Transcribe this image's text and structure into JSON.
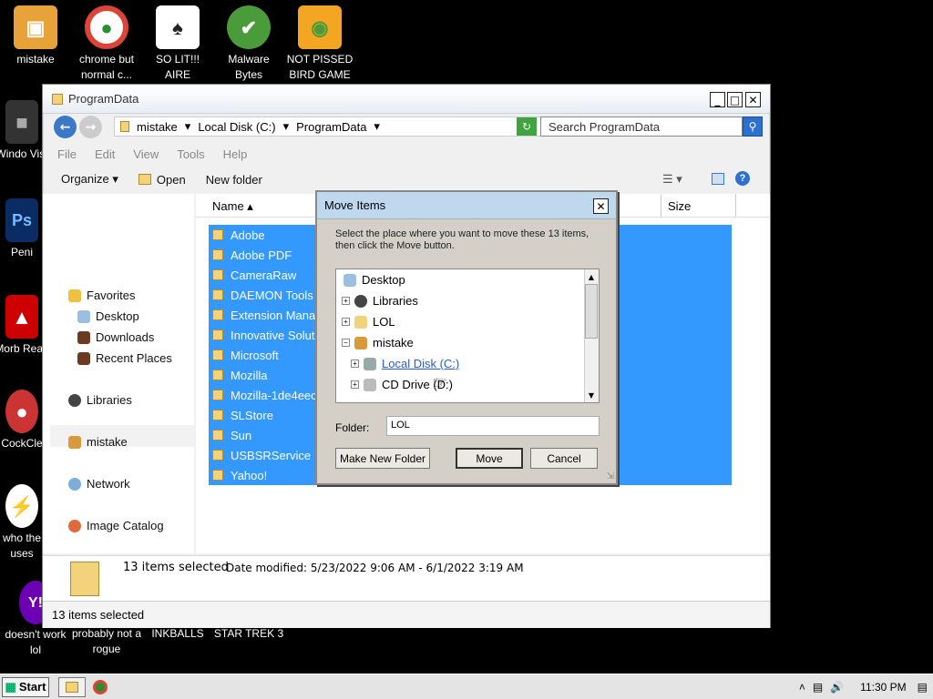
{
  "desktop": {
    "icons": [
      {
        "label": "mistake",
        "glyph": "▣",
        "color": "#e8a23a"
      },
      {
        "label": "chrome but normal c...",
        "glyph": "●",
        "color": "#2a8d2f"
      },
      {
        "label": "SO LIT!!! AIRE",
        "glyph": "♠",
        "color": "#444"
      },
      {
        "label": "Malware Bytes",
        "glyph": "✔",
        "color": "#2b8a2b"
      },
      {
        "label": "NOT PISSED BIRD GAME",
        "glyph": "◉",
        "color": "#f3a622"
      },
      {
        "label": "Windo Vist",
        "glyph": "■",
        "color": "#333"
      },
      {
        "label": "Ps",
        "glyph": "Ps",
        "color": "#0b2b63"
      },
      {
        "label": "Peni",
        "glyph": "",
        "color": "#000"
      },
      {
        "label": "Morb Read",
        "glyph": "▲",
        "color": "#c00"
      },
      {
        "label": "CockCle",
        "glyph": "●",
        "color": "#c33"
      },
      {
        "label": "who the uses",
        "glyph": "⚡",
        "color": "#f60"
      },
      {
        "label": "doesn't work lol",
        "glyph": "Y!",
        "color": "#6b00b5"
      },
      {
        "label": "probably not a rogue",
        "glyph": "",
        "color": "#000"
      },
      {
        "label": "INKBALLS",
        "glyph": "",
        "color": "#000"
      },
      {
        "label": "STAR TREK 3",
        "glyph": "",
        "color": "#000"
      }
    ]
  },
  "window": {
    "title": "ProgramData",
    "address": [
      "mistake",
      "Local Disk (C:)",
      "ProgramData"
    ],
    "search_placeholder": "Search ProgramData",
    "menu": [
      "File",
      "Edit",
      "View",
      "Tools",
      "Help"
    ],
    "toolbar": {
      "organize": "Organize ▾",
      "open": "Open",
      "new_folder": "New folder"
    },
    "nav": {
      "favorites": "Favorites",
      "desktop": "Desktop",
      "downloads": "Downloads",
      "recent": "Recent Places",
      "libraries": "Libraries",
      "mistake": "mistake",
      "network": "Network",
      "image_catalog": "Image Catalog"
    },
    "columns": {
      "name": "Name",
      "size": "Size"
    },
    "files": [
      "Adobe",
      "Adobe PDF",
      "CameraRaw",
      "DAEMON Tools",
      "Extension Mana",
      "Innovative Solut",
      "Microsoft",
      "Mozilla",
      "Mozilla-1de4eec",
      "SLStore",
      "Sun",
      "USBSRService",
      "Yahoo!"
    ],
    "details": {
      "count": "13 items selected",
      "date": "Date modified: 5/23/2022 9:06 AM - 6/1/2022 3:19 AM"
    },
    "status": "13 items selected"
  },
  "dialog": {
    "title": "Move Items",
    "instructions": "Select the place where you want to move these 13 items, then click the Move button.",
    "tree": {
      "desktop": "Desktop",
      "libraries": "Libraries",
      "lol": "LOL",
      "mistake": "mistake",
      "local_disk": "Local Disk (C:)",
      "cd_drive": "CD Drive (D:)"
    },
    "folder_label": "Folder:",
    "folder_value": "LOL",
    "buttons": {
      "make_new": "Make New Folder",
      "move": "Move",
      "cancel": "Cancel"
    }
  },
  "taskbar": {
    "start": "Start",
    "time": "11:30 PM"
  }
}
